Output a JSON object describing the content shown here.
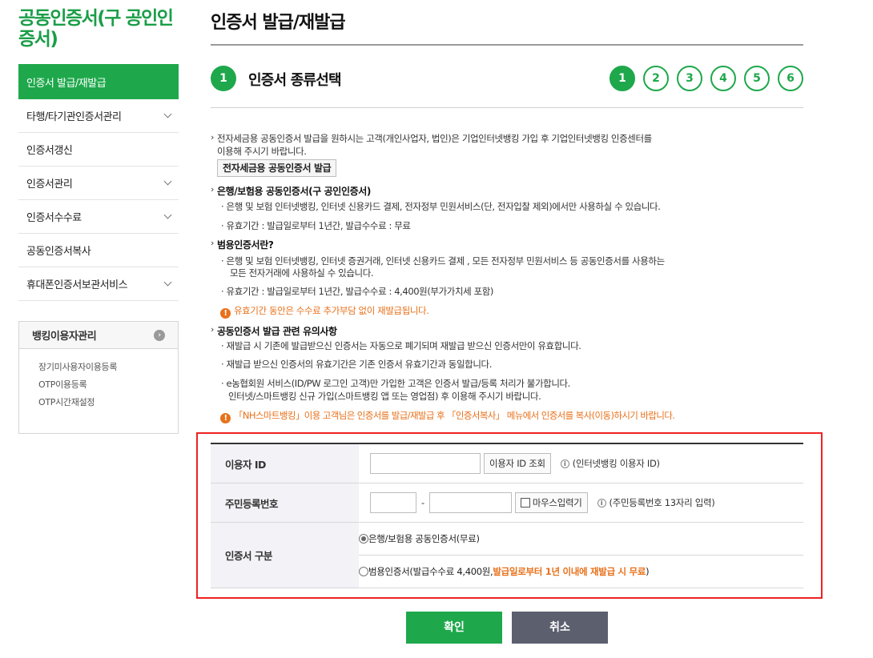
{
  "sidebar": {
    "title": "공동인증서(구 공인인증서)",
    "menu": [
      {
        "label": "인증서 발급/재발급",
        "active": true,
        "expandable": false
      },
      {
        "label": "타행/타기관인증서관리",
        "active": false,
        "expandable": true
      },
      {
        "label": "인증서갱신",
        "active": false,
        "expandable": false
      },
      {
        "label": "인증서관리",
        "active": false,
        "expandable": true
      },
      {
        "label": "인증서수수료",
        "active": false,
        "expandable": true
      },
      {
        "label": "공동인증서복사",
        "active": false,
        "expandable": false
      },
      {
        "label": "휴대폰인증서보관서비스",
        "active": false,
        "expandable": true
      }
    ],
    "banking": {
      "title": "뱅킹이용자관리",
      "links": [
        "장기미사용자이용등록",
        "OTP이용등록",
        "OTP시간재설정"
      ]
    }
  },
  "main": {
    "page_title": "인증서 발급/재발급",
    "step": {
      "current": "1",
      "title": "인증서 종류선택",
      "steps": [
        "1",
        "2",
        "3",
        "4",
        "5",
        "6"
      ]
    },
    "info": {
      "intro_line1": "전자세금용 공동인증서 발급을 원하시는 고객(개인사업자, 법인)은 기업인터넷뱅킹 가입 후 기업인터넷뱅킹 인증센터를",
      "intro_line2": "이용해 주시기 바랍니다.",
      "etax_button": "전자세금용 공동인증서 발급",
      "bank_heading": "은행/보험용 공동인증서(구 공인인증서)",
      "bank_usage": "은행 및 보험 인터넷뱅킹, 인터넷 신용카드 결제, 전자정부 민원서비스(단, 전자입찰 제외)에서만 사용하실 수 있습니다.",
      "bank_period": "유효기간 : 발급일로부터 1년간, 발급수수료 : 무료",
      "general_heading": "범용인증서란?",
      "general_usage_line1": "은행 및 보험 인터넷뱅킹, 인터넷 증권거래, 인터넷 신용카드 결제 , 모든 전자정부 민원서비스 등 공동인증서를 사용하는",
      "general_usage_line2": "모든 전자거래에 사용하실 수 있습니다.",
      "general_period": "유효기간 : 발급일로부터 1년간, 발급수수료 : 4,400원(부가가치세 포함)",
      "general_warn": "유효기간 동안은 수수료 추가부담 없이 재발급됩니다.",
      "caution_heading": "공동인증서 발급 관련 유의사항",
      "caution1": "재발급 시 기존에 발급받으신 인증서는 자동으로 폐기되며 재발급 받으신 인증서만이 유효합니다.",
      "caution2": "재발급 받으신 인증서의 유효기간은 기존 인증서 유효기간과 동일합니다.",
      "caution3_line1": "e농협회원 서비스(ID/PW 로그인 고객)만 가입한 고객은 인증서 발급/등록 처리가 불가합니다.",
      "caution3_line2": "인터넷/스마트뱅킹 신규 가입(스마트뱅킹 앱 또는 영업점) 후 이용해 주시기 바랍니다.",
      "caution_warn": "「NH스마트뱅킹」이용 고객님은 인증서를 발급/재발급 후 「인증서복사」 메뉴에서 인증서를 복사(이동)하시기 바랍니다."
    },
    "form": {
      "user_id": {
        "label": "이용자 ID",
        "value": "",
        "lookup_button": "이용자 ID 조회",
        "hint": "(인터넷뱅킹 이용자 ID)"
      },
      "resident": {
        "label": "주민등록번호",
        "front": "",
        "back": "",
        "separator": "-",
        "mouse_input": "마우스입력기",
        "hint": "(주민등록번호 13자리 입력)"
      },
      "cert_type": {
        "label": "인증서 구분",
        "option1": "은행/보험용 공동인증서(무료)",
        "option1_selected": true,
        "option2_pre": "범용인증서(발급수수료 4,400원, ",
        "option2_highlight": "발급일로부터 1년 이내에 재발급 시 무료",
        "option2_post": ")",
        "option2_selected": false
      }
    },
    "buttons": {
      "confirm": "확인",
      "cancel": "취소"
    }
  },
  "colors": {
    "brand_green": "#1ea84b",
    "warning_orange": "#e8711b",
    "highlight_red": "#ee2222",
    "cancel_gray": "#5c5f6e"
  }
}
